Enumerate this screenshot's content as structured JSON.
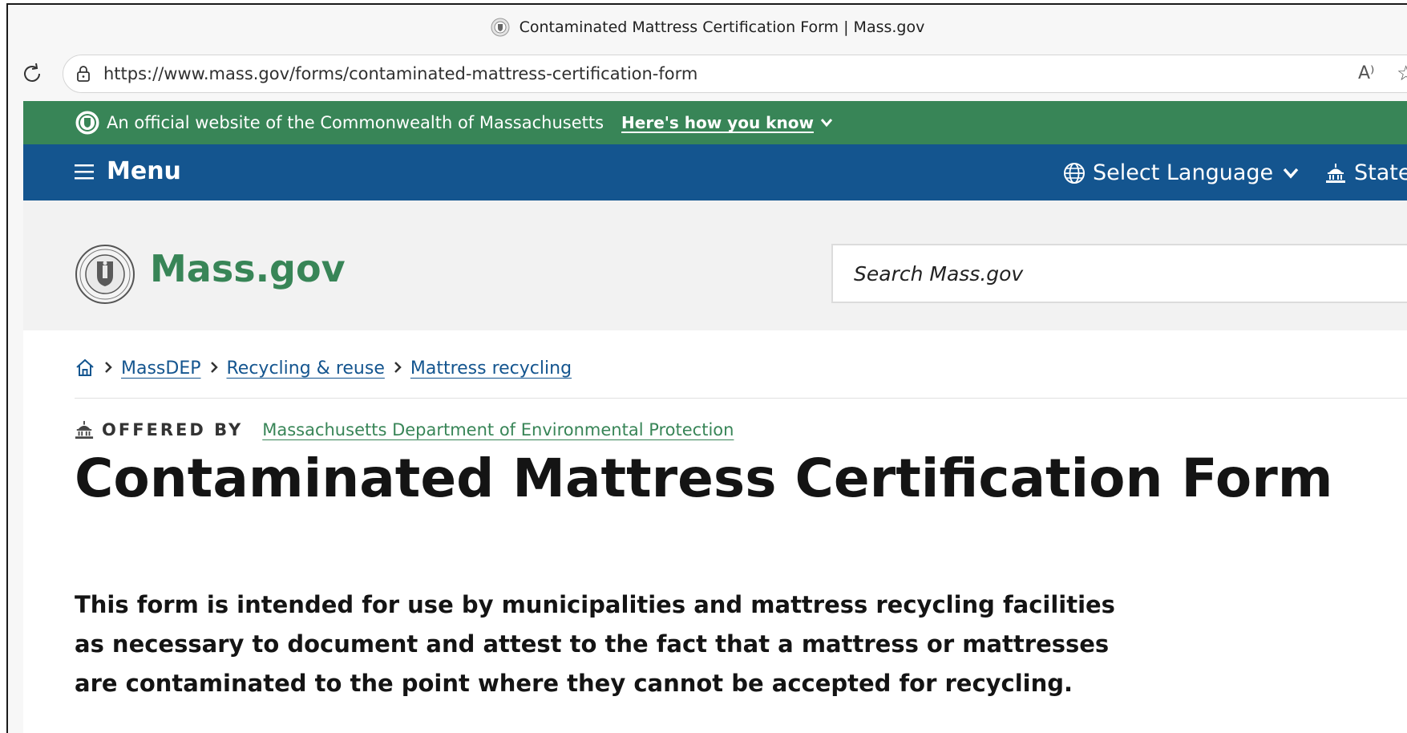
{
  "browser": {
    "tab_title": "Contaminated Mattress Certification Form | Mass.gov",
    "url": "https://www.mass.gov/forms/contaminated-mattress-certification-form",
    "read_aloud_glyph": "A⁾"
  },
  "gov_banner": {
    "official_text": "An official website of the Commonwealth of Massachusetts",
    "how_you_know": "Here's how you know"
  },
  "nav": {
    "menu_label": "Menu",
    "language_label": "Select Language",
    "state_label": "State"
  },
  "header": {
    "logo_text": "Mass.gov",
    "search_placeholder": "Search Mass.gov"
  },
  "breadcrumb": {
    "items": [
      "MassDEP",
      "Recycling & reuse",
      "Mattress recycling"
    ]
  },
  "offered_by": {
    "label": "OFFERED BY",
    "org": "Massachusetts Department of Environmental Protection"
  },
  "main": {
    "title": "Contaminated Mattress Certification Form",
    "lede": "This form is intended for use by municipalities and mattress recycling facilities as necessary to document and attest to the fact that a mattress or mattresses are contaminated to the point where they cannot be accepted for recycling."
  },
  "colors": {
    "banner_green": "#388557",
    "nav_blue": "#14558f",
    "header_gray": "#f2f2f2"
  }
}
